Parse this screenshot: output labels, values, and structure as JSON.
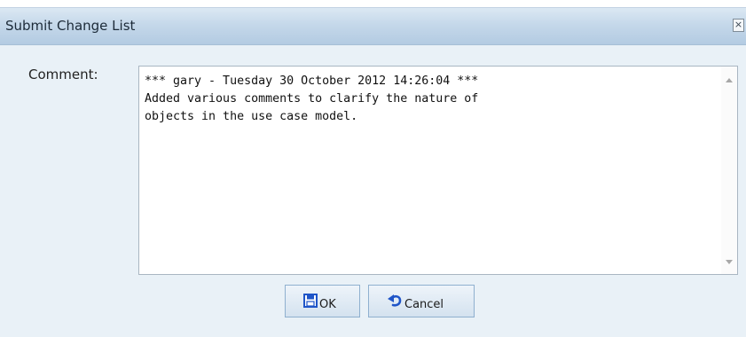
{
  "dialog": {
    "title": "Submit Change List",
    "close_glyph": "×"
  },
  "form": {
    "comment_label": "Comment:",
    "comment_value": "*** gary - Tuesday 30 October 2012 14:26:04 ***\nAdded various comments to clarify the nature of\nobjects in the use case model."
  },
  "buttons": {
    "ok_label": "OK",
    "cancel_label": "Cancel"
  },
  "icons": {
    "ok": "save-disk-icon",
    "cancel": "undo-arrow-icon"
  },
  "colors": {
    "titlebar": "#c5d8ea",
    "dialog_bg": "#e9f1f7",
    "icon_blue": "#1f55c8"
  }
}
